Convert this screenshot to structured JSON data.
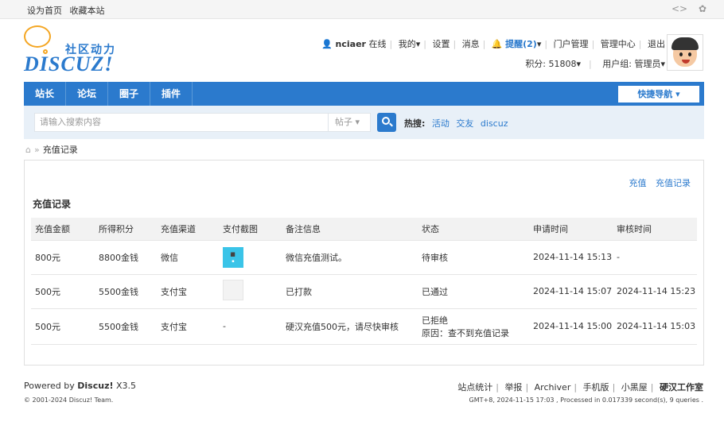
{
  "topbar": {
    "set_home": "设为首页",
    "bookmark": "收藏本站",
    "icons": [
      "code-icon",
      "palette-icon"
    ]
  },
  "logo": {
    "cn": "社区动力",
    "en": "DISCUZ!"
  },
  "user": {
    "name": "nciaer",
    "online": "在线",
    "mine": "我的",
    "settings": "设置",
    "messages": "消息",
    "remind": "提醒(2)",
    "portal": "门户管理",
    "admin": "管理中心",
    "logout": "退出",
    "credits": "积分: 51808",
    "group": "用户组: 管理员"
  },
  "nav": {
    "items": [
      "站长",
      "论坛",
      "圈子",
      "插件"
    ],
    "quick": "快捷导航"
  },
  "search": {
    "placeholder": "请输入搜索内容",
    "type": "帖子",
    "hot_label": "热搜:",
    "hot": [
      "活动",
      "交友",
      "discuz"
    ]
  },
  "breadcrumb": {
    "current": "充值记录"
  },
  "panel": {
    "links": [
      "充值",
      "充值记录"
    ],
    "title": "充值记录",
    "headers": [
      "充值金额",
      "所得积分",
      "充值渠道",
      "支付截图",
      "备注信息",
      "状态",
      "申请时间",
      "审核时间"
    ],
    "rows": [
      {
        "amount": "800元",
        "credits": "8800金钱",
        "channel": "微信",
        "screenshot": "image",
        "note": "微信充值测试。",
        "status": "待审核",
        "status_type": "pending",
        "reason": "",
        "apply": "2024-11-14 15:13",
        "review": "-"
      },
      {
        "amount": "500元",
        "credits": "5500金钱",
        "channel": "支付宝",
        "screenshot": "image2",
        "note": "已打款",
        "status": "已通过",
        "status_type": "ok",
        "reason": "",
        "apply": "2024-11-14 15:07",
        "review": "2024-11-14 15:23"
      },
      {
        "amount": "500元",
        "credits": "5500金钱",
        "channel": "支付宝",
        "screenshot": "-",
        "note": "硬汉充值500元，请尽快审核",
        "status": "已拒绝",
        "status_type": "rejected",
        "reason": "原因：查不到充值记录",
        "apply": "2024-11-14 15:00",
        "review": "2024-11-14 15:03"
      }
    ]
  },
  "footer": {
    "powered": "Powered by",
    "brand": "Discuz!",
    "version": "X3.5",
    "copyright": "© 2001-2024 Discuz! Team.",
    "links": [
      "站点统计",
      "举报",
      "Archiver",
      "手机版",
      "小黑屋"
    ],
    "studio": "硬汉工作室",
    "stats": "GMT+8, 2024-11-15 17:03 , Processed in 0.017339 second(s), 9 queries ."
  },
  "colors": {
    "accent": "#2b7acd",
    "ok": "#1aa01a",
    "bad": "#e02020"
  }
}
